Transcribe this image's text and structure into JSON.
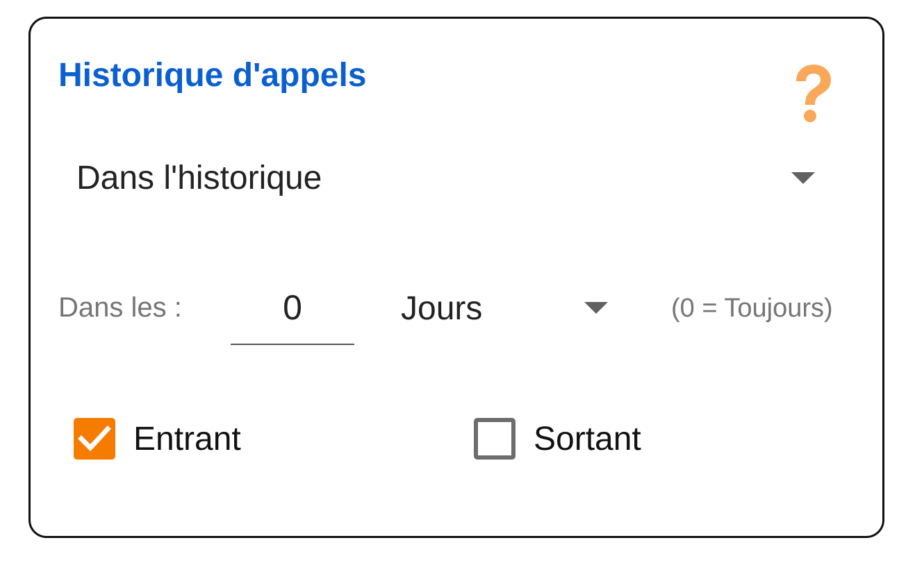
{
  "panel": {
    "title": "Historique d'appels",
    "help_icon": "question-mark-icon",
    "accent_color": "#0a5fd1",
    "help_color": "#f9a85a"
  },
  "source_select": {
    "value": "Dans l'historique",
    "icon": "dropdown-caret-icon"
  },
  "period": {
    "label": "Dans les :",
    "value": "0",
    "unit": "Jours",
    "hint": "(0 = Toujours)"
  },
  "filters": {
    "incoming": {
      "label": "Entrant",
      "checked": true,
      "color": "#f57c00"
    },
    "outgoing": {
      "label": "Sortant",
      "checked": false
    }
  }
}
